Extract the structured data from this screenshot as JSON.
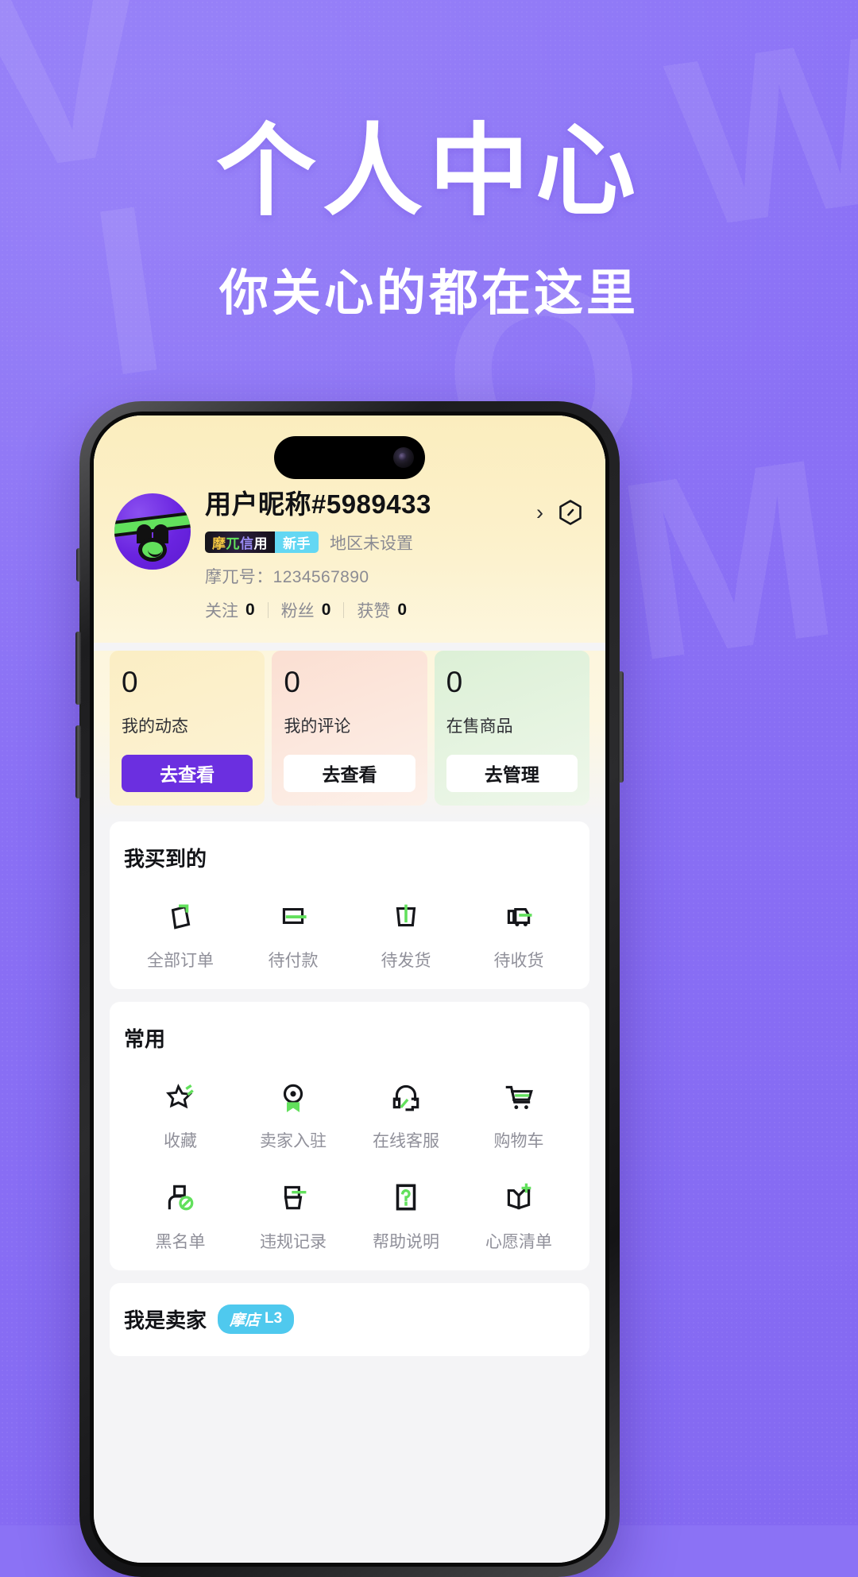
{
  "promo": {
    "title": "个人中心",
    "subtitle": "你关心的都在这里",
    "bg_letters": [
      "V",
      "I",
      "O",
      "W",
      "M"
    ],
    "bg_color": "#8b72f5"
  },
  "profile": {
    "username": "用户昵称#5989433",
    "credit_badge": "摩兀信用",
    "credit_badge_chars": [
      "摩",
      "兀",
      "信",
      "用"
    ],
    "level_badge": "新手",
    "region": "地区未设置",
    "account_id_label": "摩兀号：",
    "account_id_value": "1234567890",
    "stats": [
      {
        "label": "关注",
        "value": "0"
      },
      {
        "label": "粉丝",
        "value": "0"
      },
      {
        "label": "获赞",
        "value": "0"
      }
    ],
    "chevron": "›",
    "avatar_name": "user-avatar",
    "settings_icon": "hexagon-slash-icon",
    "header_bg": "#fbedbe"
  },
  "stat_cards": [
    {
      "count": "0",
      "label": "我的动态",
      "button": "去查看",
      "style": "yellow",
      "button_style": "purple"
    },
    {
      "count": "0",
      "label": "我的评论",
      "button": "去查看",
      "style": "pink",
      "button_style": "white"
    },
    {
      "count": "0",
      "label": "在售商品",
      "button": "去管理",
      "style": "green",
      "button_style": "white"
    }
  ],
  "purchases": {
    "title": "我买到的",
    "items": [
      {
        "label": "全部订单",
        "icon": "all-orders-icon"
      },
      {
        "label": "待付款",
        "icon": "pending-payment-icon"
      },
      {
        "label": "待发货",
        "icon": "pending-shipment-icon"
      },
      {
        "label": "待收货",
        "icon": "pending-receipt-icon"
      }
    ]
  },
  "common": {
    "title": "常用",
    "items": [
      {
        "label": "收藏",
        "icon": "star-favorite-icon"
      },
      {
        "label": "卖家入驻",
        "icon": "seller-badge-icon"
      },
      {
        "label": "在线客服",
        "icon": "headset-support-icon"
      },
      {
        "label": "购物车",
        "icon": "shopping-cart-icon"
      },
      {
        "label": "黑名单",
        "icon": "blocklist-user-icon"
      },
      {
        "label": "违规记录",
        "icon": "violation-record-icon"
      },
      {
        "label": "帮助说明",
        "icon": "help-question-icon"
      },
      {
        "label": "心愿清单",
        "icon": "wishlist-book-icon"
      }
    ]
  },
  "seller": {
    "title": "我是卖家",
    "badge_shop": "摩店",
    "badge_level": "L3"
  },
  "colors": {
    "accent_purple": "#6b2fe0",
    "accent_green": "#62e05c",
    "accent_cyan": "#4fc9ee",
    "text_primary": "#121317",
    "text_muted": "#90909a"
  }
}
